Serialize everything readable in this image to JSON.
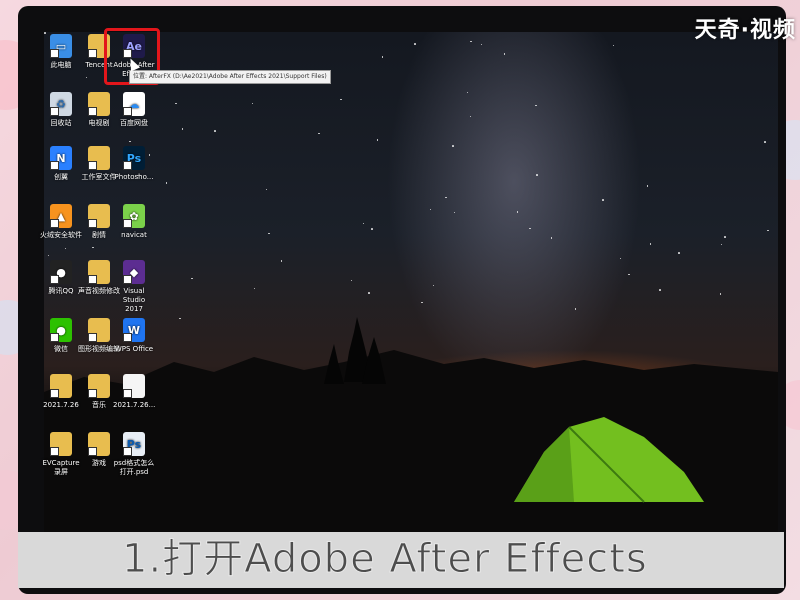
{
  "watermark": "天奇·视频",
  "caption": "1.打开Adobe After Effects",
  "tooltip": "位置: AfterFX (D:\\Ae2021\\Adobe After Effects 2021\\Support Files)",
  "desktop_icons": [
    {
      "label": "此电脑",
      "icon": "computer-icon"
    },
    {
      "label": "Tencent",
      "icon": "folder-icon"
    },
    {
      "label": "Adobe After Effects",
      "icon": "after-effects-icon"
    },
    {
      "label": "回收站",
      "icon": "recycle-bin-icon"
    },
    {
      "label": "电视剧",
      "icon": "folder-icon"
    },
    {
      "label": "百度网盘",
      "icon": "baidu-netdisk-icon"
    },
    {
      "label": "创翼",
      "icon": "chuangyi-icon"
    },
    {
      "label": "工作室文件",
      "icon": "folder-icon"
    },
    {
      "label": "Photosho...",
      "icon": "photoshop-icon"
    },
    {
      "label": "火绒安全软件",
      "icon": "huorong-icon"
    },
    {
      "label": "剧情",
      "icon": "folder-icon"
    },
    {
      "label": "navicat",
      "icon": "navicat-icon"
    },
    {
      "label": "腾讯QQ",
      "icon": "qq-icon"
    },
    {
      "label": "声音视频修改",
      "icon": "folder-icon"
    },
    {
      "label": "Visual Studio 2017",
      "icon": "visual-studio-icon"
    },
    {
      "label": "微信",
      "icon": "wechat-icon"
    },
    {
      "label": "图形视频编辑",
      "icon": "folder-icon"
    },
    {
      "label": "WPS Office",
      "icon": "wps-icon"
    },
    {
      "label": "2021.7.26",
      "icon": "folder-icon"
    },
    {
      "label": "音乐",
      "icon": "folder-icon"
    },
    {
      "label": "2021.7.26...",
      "icon": "document-icon"
    },
    {
      "label": "EVCapture录屏",
      "icon": "folder-icon"
    },
    {
      "label": "游戏",
      "icon": "folder-icon"
    },
    {
      "label": "psd格式怎么打开.psd",
      "icon": "psd-file-icon"
    }
  ],
  "icon_glyphs": {
    "ae": "Ae",
    "ps": "Ps",
    "psd": "Ps",
    "wps": "W",
    "vs": "◆",
    "qq": "●",
    "wechat": "●",
    "pc": "▭",
    "bin": "♻",
    "baidu": "☁"
  }
}
